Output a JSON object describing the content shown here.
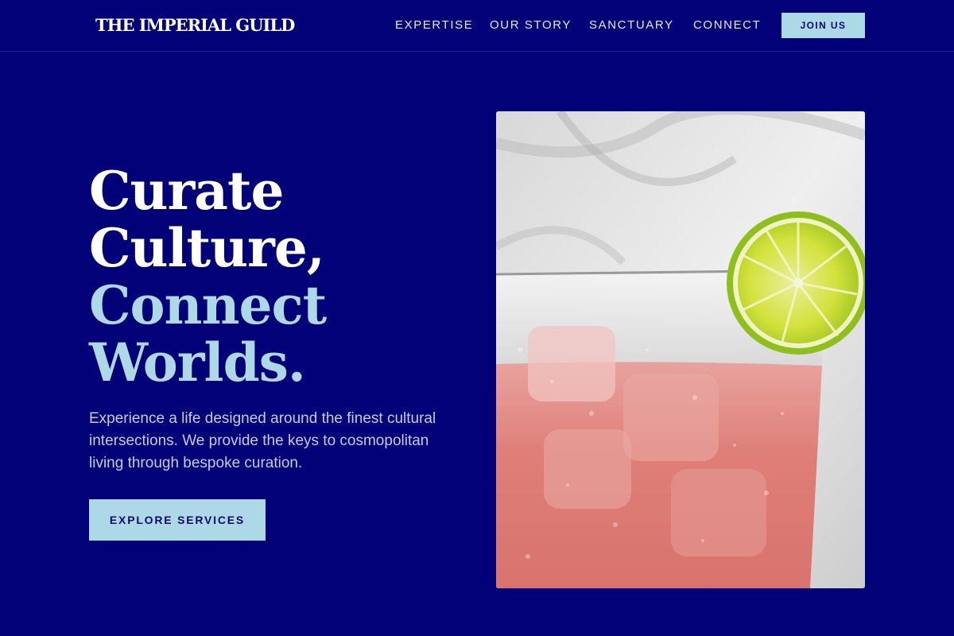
{
  "brand": {
    "name": "THE IMPERIAL GUILD"
  },
  "nav": {
    "items": [
      {
        "label": "EXPERTISE"
      },
      {
        "label": "OUR STORY"
      },
      {
        "label": "SANCTUARY"
      },
      {
        "label": "CONNECT"
      }
    ],
    "cta_label": "JOIN US"
  },
  "hero": {
    "title_lines": [
      "Curate",
      "Culture,",
      "Connect",
      "Worlds."
    ],
    "subtitle": "Experience a life designed around the finest cultural intersections. We provide the keys to cosmopolitan living through bespoke curation.",
    "cta_label": "EXPLORE SERVICES",
    "image_icon": "cocktail-with-lime-photo"
  },
  "colors": {
    "background": "#020178",
    "accent": "#add8e6",
    "text": "#ffffff"
  }
}
